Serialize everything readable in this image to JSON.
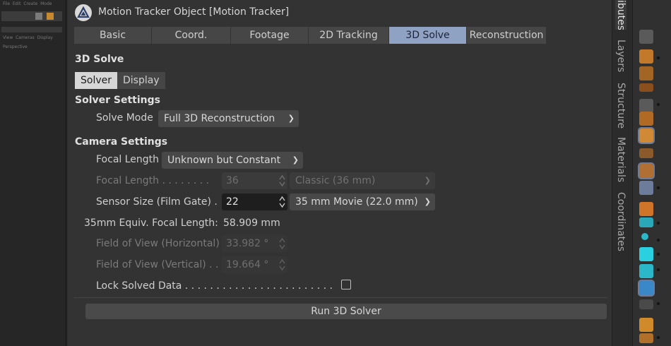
{
  "left_panel": {
    "menu_items": [
      "File",
      "Edit",
      "Create",
      "Mode"
    ],
    "toolbar_items": [
      "View",
      "Cameras",
      "Display"
    ],
    "viewport_label": "Perspective"
  },
  "attributes": {
    "title": "Motion Tracker Object [Motion Tracker]",
    "tabs": [
      {
        "label": "Basic",
        "active": false
      },
      {
        "label": "Coord.",
        "active": false
      },
      {
        "label": "Footage",
        "active": false
      },
      {
        "label": "2D Tracking",
        "active": false
      },
      {
        "label": "3D Solve",
        "active": true
      },
      {
        "label": "Reconstruction",
        "active": false
      }
    ],
    "section_title": "3D Solve",
    "subtabs": [
      {
        "label": "Solver",
        "active": true
      },
      {
        "label": "Display",
        "active": false
      }
    ],
    "solver_settings": {
      "heading": "Solver Settings",
      "solve_mode_label": "Solve Mode",
      "solve_mode_value": "Full 3D Reconstruction"
    },
    "camera_settings": {
      "heading": "Camera Settings",
      "focal_length_mode_label": "Focal Length",
      "focal_length_mode_value": "Unknown but Constant",
      "focal_length_label": "Focal Length . . . . . . . .",
      "focal_length_value": "36",
      "focal_length_preset": "Classic (36 mm)",
      "sensor_size_label": "Sensor Size (Film Gate) .",
      "sensor_size_value": "22",
      "sensor_size_preset": "35 mm Movie (22.0 mm)",
      "equiv_label": "35mm Equiv. Focal Length:",
      "equiv_value": "58.909 mm",
      "fov_h_label": "Field of View (Horizontal)",
      "fov_h_value": "33.982 °",
      "fov_v_label": "Field of View (Vertical) . .",
      "fov_v_value": "19.664 °",
      "lock_label": "Lock Solved Data . . . . . . . . . . . . . . . . . . . . . . . .",
      "lock_checked": false
    },
    "run_button_label": "Run 3D Solver"
  },
  "right_tabs": [
    {
      "label": "Attributes",
      "visible_text": "ibutes",
      "active": true
    },
    {
      "label": "Layers",
      "active": false
    },
    {
      "label": "Structure",
      "active": false
    },
    {
      "label": "Materials",
      "active": false
    },
    {
      "label": "Coordinates",
      "active": false
    }
  ],
  "colors": {
    "active_tab": "#8fa2c4",
    "panel_bg": "#333333",
    "field_dark": "#1e1e1e"
  }
}
